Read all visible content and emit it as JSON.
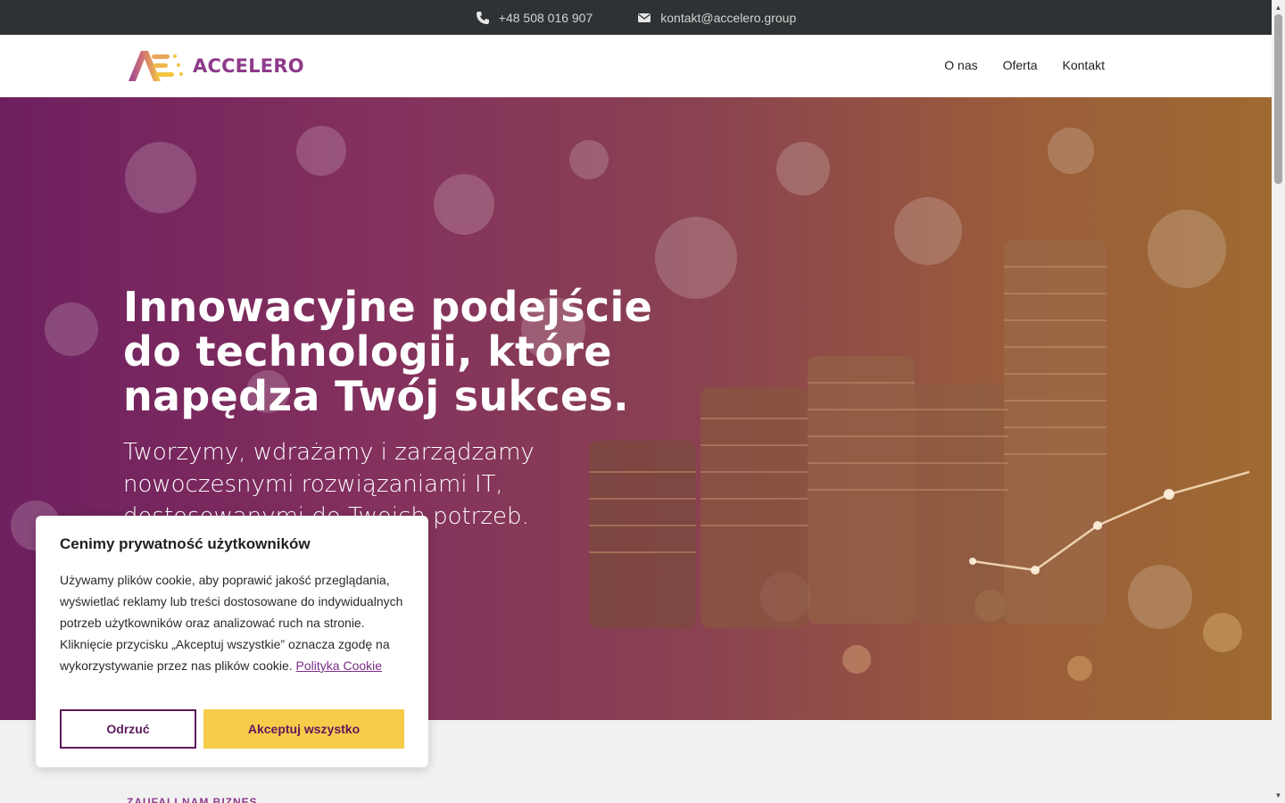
{
  "topbar": {
    "phone": "+48 508 016 907",
    "email": "kontakt@accelero.group"
  },
  "header": {
    "logo_text": "ACCELERO",
    "nav": [
      "O nas",
      "Oferta",
      "Kontakt"
    ]
  },
  "hero": {
    "title_lines": [
      "Innowacyjne podejście",
      "do technologii, które",
      "napędza Twój sukces."
    ],
    "subtitle_lines": [
      "Tworzymy, wdrażamy i zarządzamy",
      "nowoczesnymi rozwiązaniami IT,",
      "dostosowanymi do Twoich potrzeb."
    ]
  },
  "below": {
    "label": "ZAUFALI NAM BIZNES"
  },
  "cookie": {
    "title": "Cenimy prywatność użytkowników",
    "text": "Używamy plików cookie, aby poprawić jakość przeglądania, wyświetlać reklamy lub treści dostosowane do indywidualnych potrzeb użytkowników oraz analizować ruch na stronie. Kliknięcie przycisku „Akceptuj wszystkie” oznacza zgodę na wykorzystywanie przez nas plików cookie.",
    "link": "Polityka Cookie",
    "reject_label": "Odrzuć",
    "accept_label": "Akceptuj wszystko"
  },
  "colors": {
    "brand": "#8e3a8b",
    "accent": "#f7cc4a",
    "topbar": "#2f3234"
  }
}
